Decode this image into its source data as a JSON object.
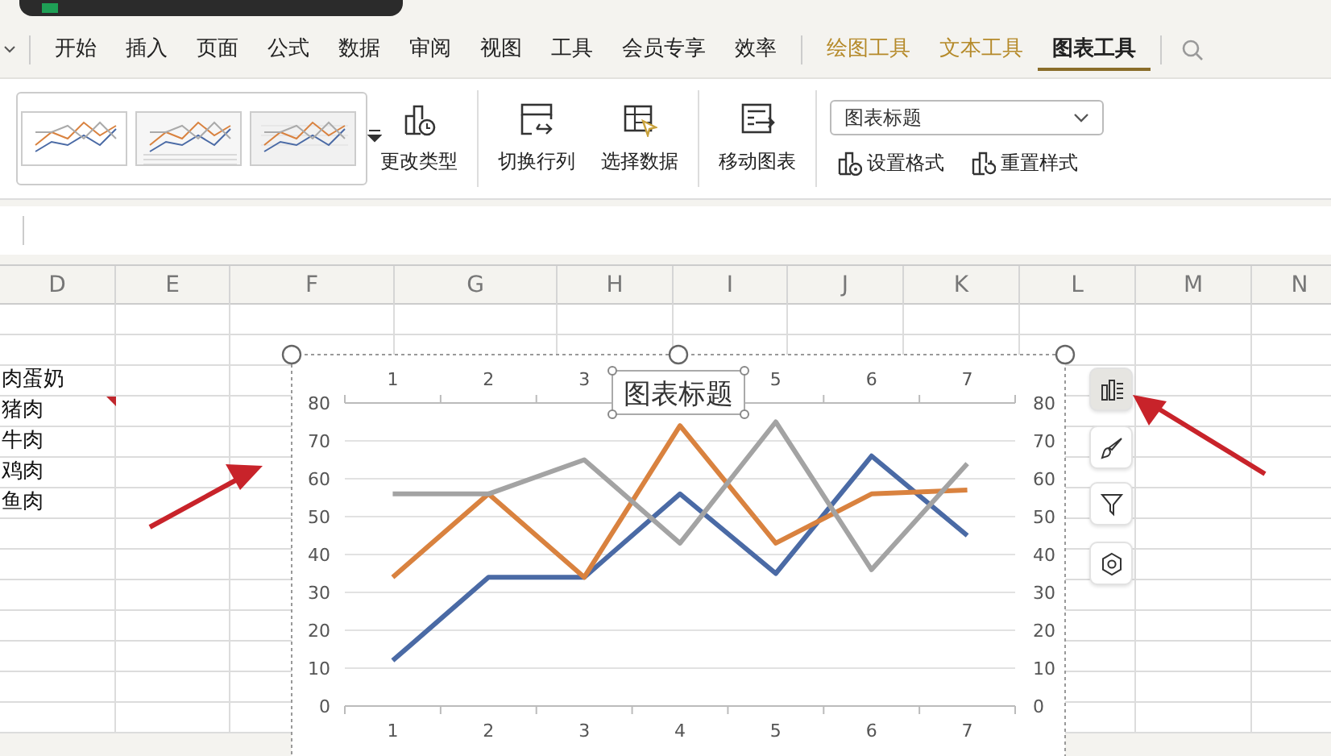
{
  "menu_tabs": [
    {
      "label": "开始",
      "kind": "main",
      "selected": false
    },
    {
      "label": "插入",
      "kind": "main",
      "selected": false
    },
    {
      "label": "页面",
      "kind": "main",
      "selected": false
    },
    {
      "label": "公式",
      "kind": "main",
      "selected": false
    },
    {
      "label": "数据",
      "kind": "main",
      "selected": false
    },
    {
      "label": "审阅",
      "kind": "main",
      "selected": false
    },
    {
      "label": "视图",
      "kind": "main",
      "selected": false
    },
    {
      "label": "工具",
      "kind": "main",
      "selected": false
    },
    {
      "label": "会员专享",
      "kind": "main",
      "selected": false
    },
    {
      "label": "效率",
      "kind": "main",
      "selected": false
    },
    {
      "label": "绘图工具",
      "kind": "context",
      "selected": false
    },
    {
      "label": "文本工具",
      "kind": "context",
      "selected": false
    },
    {
      "label": "图表工具",
      "kind": "context",
      "selected": true
    }
  ],
  "ribbon": {
    "styles": [
      {
        "kind": "plain"
      },
      {
        "kind": "table"
      },
      {
        "kind": "grid"
      }
    ],
    "groups": [
      [
        {
          "label": "更改类型",
          "kind": "change-type"
        }
      ],
      [
        {
          "label": "切换行列",
          "kind": "switch"
        },
        {
          "label": "选择数据",
          "kind": "select-data"
        }
      ],
      [
        {
          "label": "移动图表",
          "kind": "move"
        }
      ]
    ],
    "element_dropdown": {
      "value": "图表标题"
    },
    "small_buttons": [
      {
        "label": "设置格式",
        "kind": "format"
      },
      {
        "label": "重置样式",
        "kind": "reset"
      }
    ]
  },
  "sheet": {
    "columns": [
      "D",
      "E",
      "F",
      "G",
      "H",
      "I",
      "J",
      "K",
      "L",
      "M",
      "N"
    ],
    "column_d_cells": [
      {
        "text": "肉蛋奶",
        "comment": false
      },
      {
        "text": "猪肉",
        "comment": true
      },
      {
        "text": "牛肉",
        "comment": false
      },
      {
        "text": "鸡肉",
        "comment": false
      },
      {
        "text": "鱼肉",
        "comment": false
      }
    ],
    "chart": {
      "title": "图表标题",
      "selected": true,
      "chart_data": {
        "type": "line",
        "grid": true,
        "categories": [
          "1",
          "2",
          "3",
          "4",
          "5",
          "6",
          "7"
        ],
        "ylim": [
          0,
          80
        ],
        "yticks": [
          0,
          10,
          20,
          30,
          40,
          50,
          60,
          70,
          80
        ],
        "y2lim": [
          0,
          80
        ],
        "y2ticks": [
          0,
          10,
          20,
          30,
          40,
          50,
          60,
          70,
          80
        ],
        "series": [
          {
            "color": "#4a6aa5",
            "values": [
              12,
              34,
              34,
              56,
              35,
              66,
              45
            ]
          },
          {
            "color": "#d9823f",
            "values": [
              34,
              56,
              34,
              74,
              43,
              56,
              57
            ]
          },
          {
            "color": "#a3a3a3",
            "values": [
              56,
              56,
              65,
              43,
              75,
              36,
              64
            ]
          }
        ]
      }
    },
    "chart_side_buttons": [
      {
        "kind": "elements",
        "selected": true
      },
      {
        "kind": "style",
        "selected": false
      },
      {
        "kind": "filter",
        "selected": false
      },
      {
        "kind": "settings",
        "selected": false
      }
    ]
  }
}
